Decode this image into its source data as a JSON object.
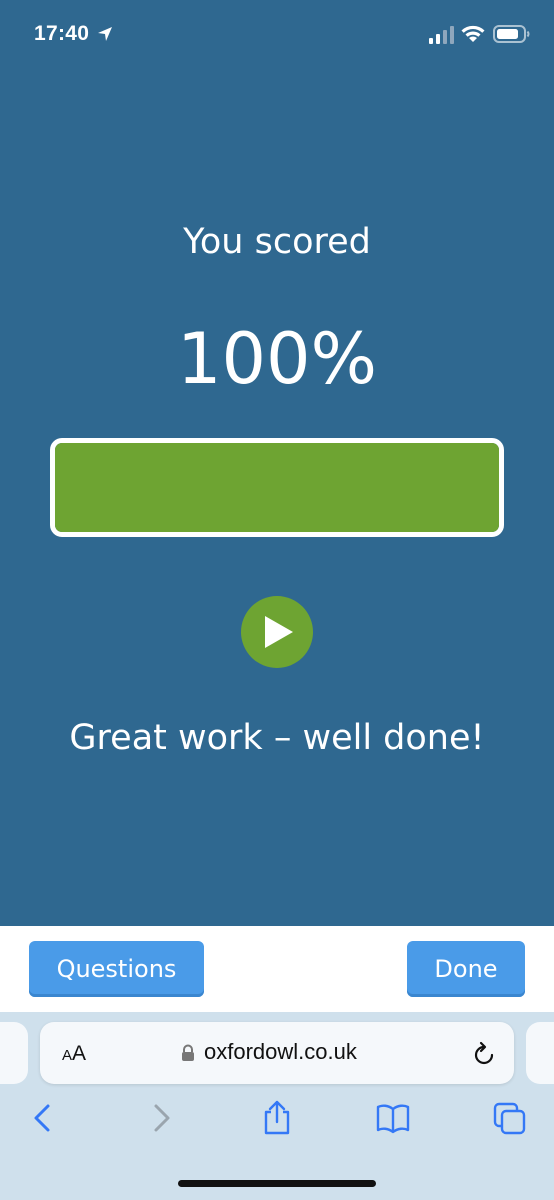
{
  "status_bar": {
    "time": "17:40",
    "icons": [
      "location-arrow-icon",
      "signal-icon",
      "wifi-icon",
      "battery-icon"
    ]
  },
  "result": {
    "label": "You scored",
    "score": "100%",
    "progress_percent": 100,
    "feedback": "Great work – well done!"
  },
  "toolbar": {
    "questions_label": "Questions",
    "done_label": "Done"
  },
  "safari": {
    "aa_small": "A",
    "aa_large": "A",
    "url": "oxfordowl.co.uk",
    "nav_icons": [
      "back-icon",
      "forward-icon",
      "share-icon",
      "bookmarks-icon",
      "tabs-icon"
    ]
  },
  "colors": {
    "background": "#2f6890",
    "progress_fill": "#6ea432",
    "button": "#4a9be8",
    "safari_bar": "#cfe0ec",
    "ios_blue": "#3478f6"
  }
}
